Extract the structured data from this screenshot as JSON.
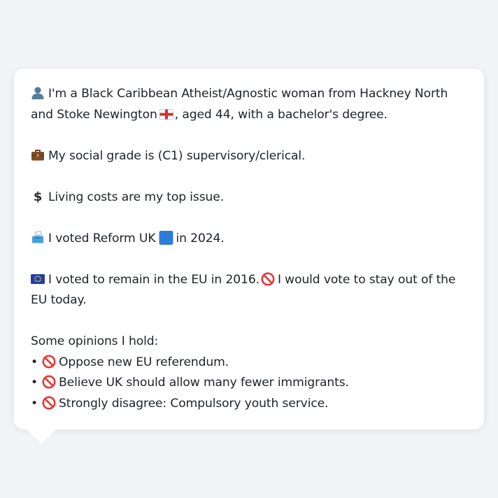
{
  "colors": {
    "page_background": "#f2f3f5",
    "bubble_background": "#ffffff",
    "text": "#1f2328",
    "reform_blue": "#2f7bd8",
    "prohibited_red": "#e53935"
  },
  "icons": {
    "person": "bust-in-silhouette-icon",
    "england_flag": "england-flag-icon",
    "briefcase": "briefcase-icon",
    "dollar": "heavy-dollar-sign-icon",
    "ballot": "ballot-box-icon",
    "blue_square": "large-blue-square-icon",
    "eu_flag": "eu-flag-icon",
    "prohibited": "prohibited-icon"
  },
  "profile": {
    "identity_pre": "I'm a Black Caribbean Atheist/Agnostic woman from Hackney North and Stoke Newington",
    "identity_post": ", aged 44, with a bachelor's degree.",
    "social_grade": "My social grade is (C1) supervisory/clerical.",
    "top_issue": "Living costs are my top issue.",
    "vote_pre": "I voted Reform UK",
    "vote_post": "in 2024.",
    "eu_2016": "I voted to remain in the EU in 2016.",
    "eu_today": "I would vote to stay out of the EU today.",
    "opinions_heading": "Some opinions I hold:",
    "bullet_char": "•",
    "opinions": [
      "Oppose new EU referendum.",
      "Believe UK should allow many fewer immigrants.",
      "Strongly disagree: Compulsory youth service."
    ]
  }
}
